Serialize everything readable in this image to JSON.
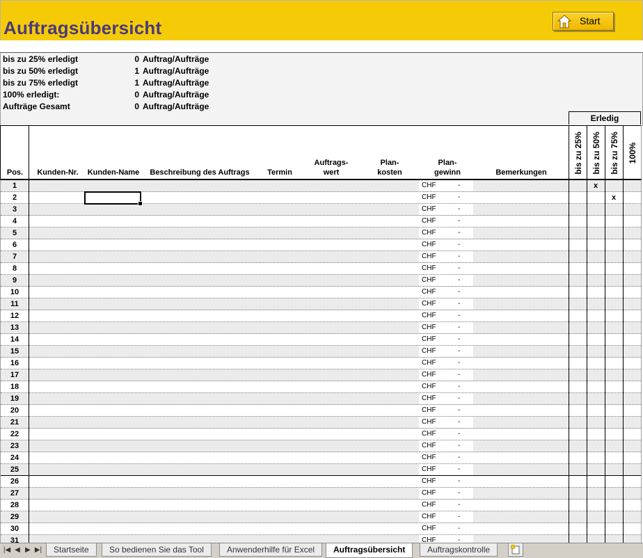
{
  "title": "Auftragsübersicht",
  "start_button": {
    "label": "Start",
    "icon": "house-icon"
  },
  "summary": [
    {
      "label": "bis zu 25% erledigt",
      "count": "0",
      "unit": "Auftrag/Aufträge"
    },
    {
      "label": "bis zu 50% erledigt",
      "count": "1",
      "unit": "Auftrag/Aufträge"
    },
    {
      "label": "bis zu 75% erledigt",
      "count": "1",
      "unit": "Auftrag/Aufträge"
    },
    {
      "label": "100% erledigt:",
      "count": "0",
      "unit": "Auftrag/Aufträge"
    },
    {
      "label": "Aufträge Gesamt",
      "count": "0",
      "unit": "Auftrag/Aufträge"
    }
  ],
  "erledig_label": "Erledig",
  "headers": {
    "pos": "Pos.",
    "kunden_nr": "Kunden-Nr.",
    "kunden_name": "Kunden-Name",
    "beschreibung": "Beschreibung des Auftrags",
    "termin": "Termin",
    "auftragswert_1": "Auftrags-",
    "auftragswert_2": "wert",
    "plankosten_1": "Plan-",
    "plankosten_2": "kosten",
    "plangewinn_1": "Plan-",
    "plangewinn_2": "gewinn",
    "bemerkungen": "Bemerkungen",
    "p25": "bis zu 25%",
    "p50": "bis zu 50%",
    "p75": "bis zu 75%",
    "p100": "100%"
  },
  "currency": "CHF",
  "empty_value": "-",
  "marks": [
    {
      "row": 1,
      "col": "p50",
      "text": "x"
    },
    {
      "row": 2,
      "col": "p75",
      "text": "x"
    }
  ],
  "row_count": 31,
  "tabs": [
    {
      "label": "Startseite",
      "active": false
    },
    {
      "label": "So bedienen Sie das Tool",
      "active": false
    },
    {
      "label": "Anwenderhilfe für Excel",
      "active": false
    },
    {
      "label": "Auftragsübersicht",
      "active": true
    },
    {
      "label": "Auftragskontrolle",
      "active": false
    }
  ],
  "colors": {
    "title_band": "#f5cb08",
    "title_text": "#4a3a7c",
    "row_alt": "#ebebeb"
  }
}
